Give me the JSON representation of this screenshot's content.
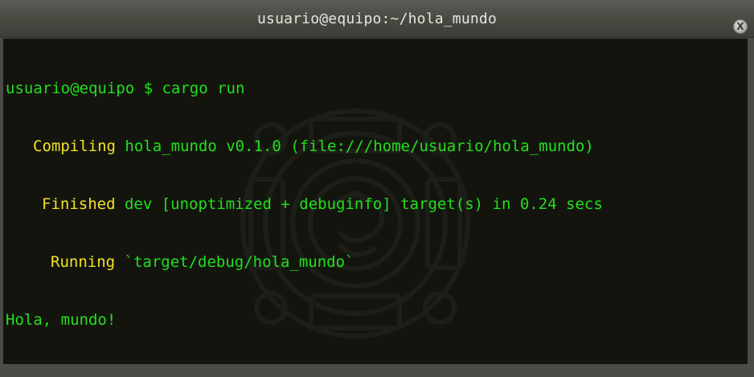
{
  "window": {
    "title": "usuario@equipo:~/hola_mundo",
    "close_glyph": "X"
  },
  "colors": {
    "prompt_green": "#21e01d",
    "status_yellow": "#f3e223",
    "terminal_bg": "#14140f"
  },
  "terminal": {
    "prompt": "usuario@equipo $ ",
    "command": "cargo run",
    "output": [
      {
        "status": "Compiling",
        "text": " hola_mundo v0.1.0 (file:///home/usuario/hola_mundo)"
      },
      {
        "status": "Finished",
        "text": " dev [unoptimized + debuginfo] target(s) in 0.24 secs"
      },
      {
        "status": "Running",
        "text": " `target/debug/hola_mundo`"
      }
    ],
    "program_output": "Hola, mundo!"
  },
  "icons": {
    "close": "close-icon",
    "watermark": "aztec-sun-stone-icon"
  }
}
